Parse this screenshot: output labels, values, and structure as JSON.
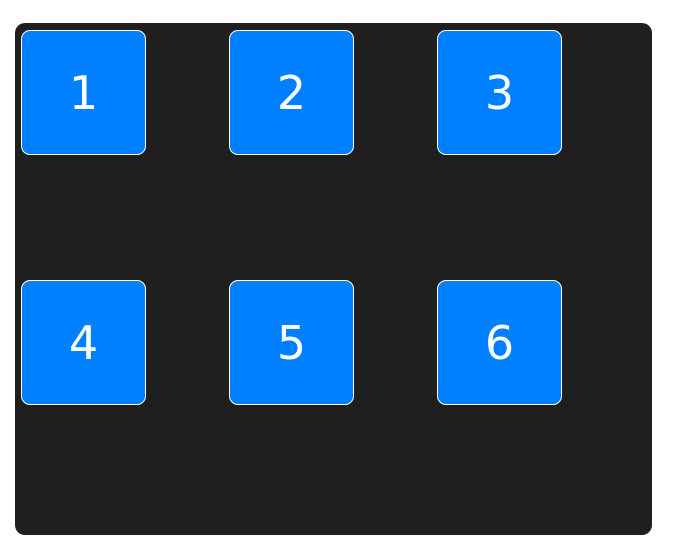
{
  "colors": {
    "panel_background": "#1f1f1f",
    "tile_background": "#0080ff",
    "tile_border": "#ffffff",
    "tile_text": "#ffffff"
  },
  "grid": {
    "tiles": [
      {
        "label": "1"
      },
      {
        "label": "2"
      },
      {
        "label": "3"
      },
      {
        "label": "4"
      },
      {
        "label": "5"
      },
      {
        "label": "6"
      }
    ]
  }
}
